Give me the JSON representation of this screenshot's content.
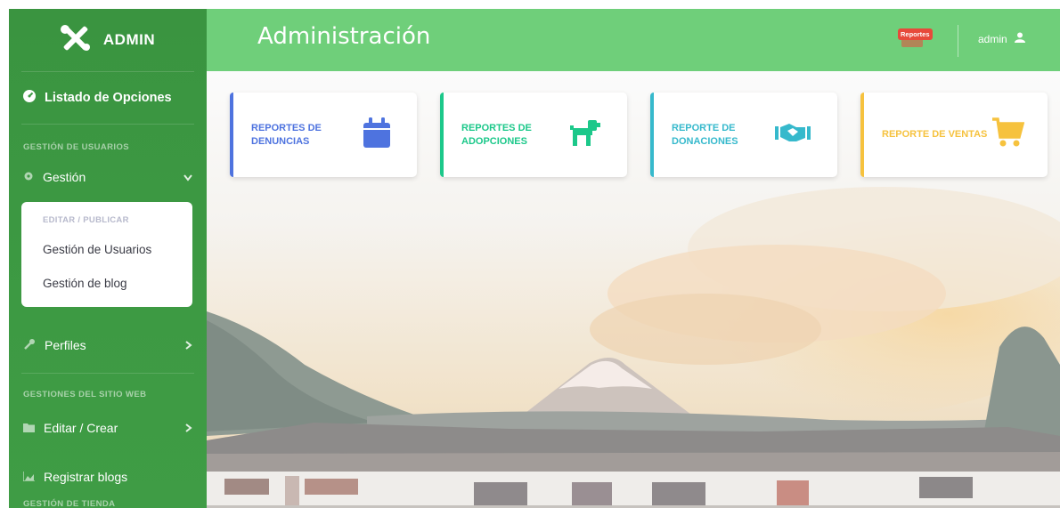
{
  "sidebar": {
    "brand": "ADMIN",
    "options_label": "Listado de Opciones",
    "heading_users": "GESTIÓN DE USUARIOS",
    "gestion_label": "Gestión",
    "collapse": {
      "heading": "EDITAR / PUBLICAR",
      "links": [
        "Gestión de Usuarios",
        "Gestión de blog"
      ]
    },
    "perfiles_label": "Perfiles",
    "heading_site": "GESTIONES DEL SITIO WEB",
    "editar_label": "Editar / Crear",
    "registrar_label": "Registrar blogs",
    "heading_store": "GESTIÓN DE TIENDA"
  },
  "topbar": {
    "title": "Administración",
    "reports_badge": "Reportes",
    "user": "admin"
  },
  "cards": [
    {
      "line1": "REPORTES DE",
      "line2": "DENUNCIAS",
      "color": "#4e73df",
      "icon": "calendar-icon"
    },
    {
      "line1": "REPORTES DE",
      "line2": "ADOPCIONES",
      "color": "#1cc88a",
      "icon": "dog-icon"
    },
    {
      "line1": "REPORTE DE",
      "line2": "DONACIONES",
      "color": "#36b9cc",
      "icon": "handshake-icon"
    },
    {
      "line1": "REPORTE DE VENTAS",
      "line2": "",
      "color": "#f6c23e",
      "icon": "cart-icon"
    }
  ],
  "colors": {
    "sidebar": "#3d9a43",
    "topbar": "#6fcf7a"
  }
}
